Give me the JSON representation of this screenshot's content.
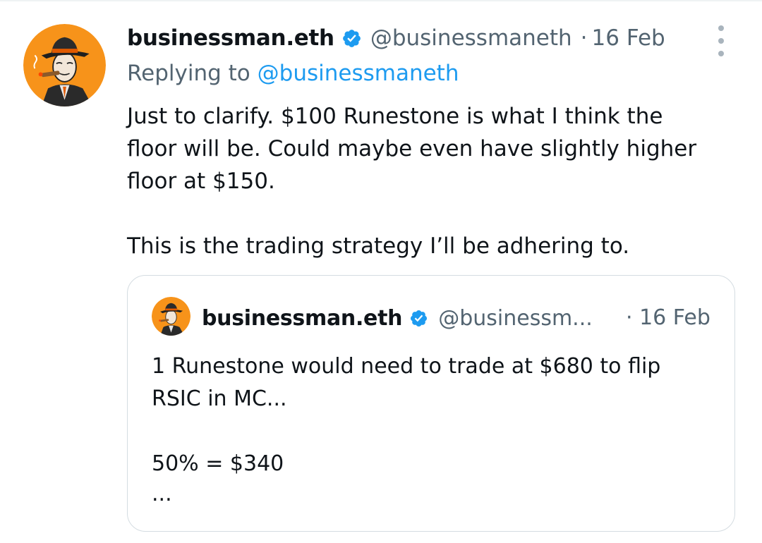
{
  "tweet": {
    "author_name": "businessman.eth",
    "author_handle": "@businessmaneth",
    "separator": "·",
    "date": "16 Feb",
    "replying_prefix": "Replying to",
    "replying_mention": "@businessmaneth",
    "body": {
      "line1": "Just to clarify. $100 Runestone is what I think the",
      "line2": "floor will be. Could maybe even have slightly higher",
      "line3": "floor at $150.",
      "line4": "This is the trading strategy I’ll be adhering to."
    },
    "verified_icon": "verified-badge-icon",
    "more_icon": "more-options-icon"
  },
  "quote": {
    "author_name": "businessman.eth",
    "author_handle": "@businessm...",
    "date": "· 16 Feb",
    "body": {
      "line1": "1 Runestone would need to trade at $680 to flip",
      "line2": "RSIC in MC...",
      "line3": "50% = $340",
      "line4": "..."
    }
  },
  "colors": {
    "verified_blue": "#1d9bf0",
    "avatar_orange": "#f7931a",
    "secondary_text": "#536471",
    "primary_text": "#0f1419"
  }
}
